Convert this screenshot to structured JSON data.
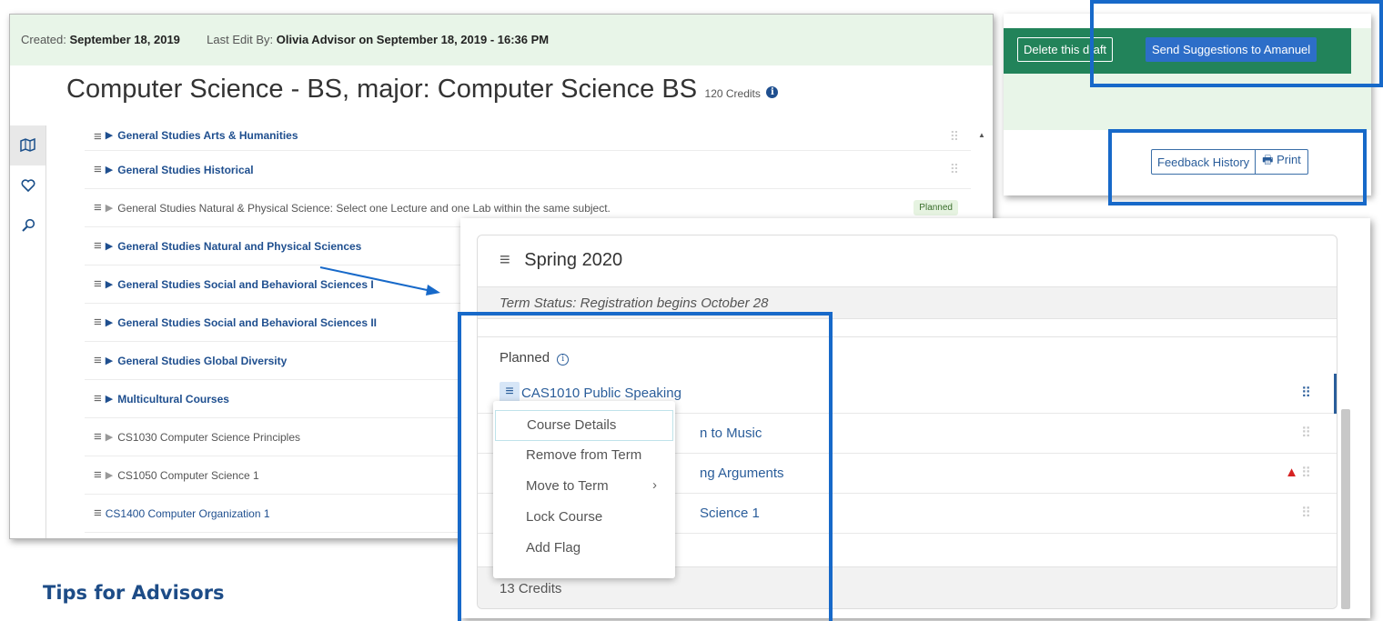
{
  "created_bar": {
    "created_label": "Created:",
    "created_date": "September 18, 2019",
    "last_edit_label": "Last Edit By:",
    "last_edit_value": "Olivia Advisor on September 18, 2019 - 16:36 PM"
  },
  "plan": {
    "title": "Computer Science - BS, major: Computer Science BS",
    "credits": "120 Credits",
    "info_icon": "info-circle-icon"
  },
  "left_rail": {
    "icons": [
      "map-icon",
      "heart-icon",
      "search-icon"
    ]
  },
  "requirements": [
    {
      "label": "General Studies Arts & Humanities",
      "style": "bold",
      "marker": "triangle"
    },
    {
      "label": "General Studies Historical",
      "style": "bold",
      "marker": "triangle"
    },
    {
      "label": "General Studies Natural & Physical Science: Select one Lecture and one Lab within the same subject.",
      "style": "plain",
      "marker": "triangle-grey",
      "badge": "Planned"
    },
    {
      "label": "General Studies Natural and Physical Sciences",
      "style": "bold",
      "marker": "triangle"
    },
    {
      "label": "General Studies Social and Behavioral Sciences I",
      "style": "bold",
      "marker": "triangle"
    },
    {
      "label": "General Studies Social and Behavioral Sciences II",
      "style": "bold",
      "marker": "triangle"
    },
    {
      "label": "General Studies Global Diversity",
      "style": "bold",
      "marker": "triangle"
    },
    {
      "label": "Multicultural Courses",
      "style": "bold",
      "marker": "triangle"
    },
    {
      "label": "CS1030 Computer Science Principles",
      "style": "plain",
      "marker": "triangle-grey"
    },
    {
      "label": "CS1050 Computer Science 1",
      "style": "plain",
      "marker": "triangle-grey"
    },
    {
      "label": "CS1400 Computer Organization 1",
      "style": "link",
      "marker": "none"
    }
  ],
  "actions": {
    "delete_draft": "Delete this draft",
    "send_suggestions": "Send Suggestions to Amanuel",
    "feedback_history": "Feedback History",
    "print": "Print",
    "print_icon": "printer-icon"
  },
  "term": {
    "name": "Spring 2020",
    "status": "Term Status: Registration begins October 28",
    "planned_label": "Planned",
    "courses": [
      {
        "label": "CAS1010 Public Speaking",
        "selected": true
      },
      {
        "label": "n to Music",
        "selected": false
      },
      {
        "label": "ng Arguments",
        "selected": false,
        "warning": true
      },
      {
        "label": "Science 1",
        "selected": false
      }
    ],
    "total_credits": "13 Credits"
  },
  "context_menu": {
    "items": [
      "Course Details",
      "Remove from Term",
      "Move to Term",
      "Lock Course",
      "Add Flag"
    ]
  },
  "footer": {
    "tips": "Tips for Advisors"
  },
  "colors": {
    "accent": "#1769c9",
    "brand_blue": "#1f4f8f",
    "success_green": "#22835a",
    "warning_red": "#d62222"
  }
}
